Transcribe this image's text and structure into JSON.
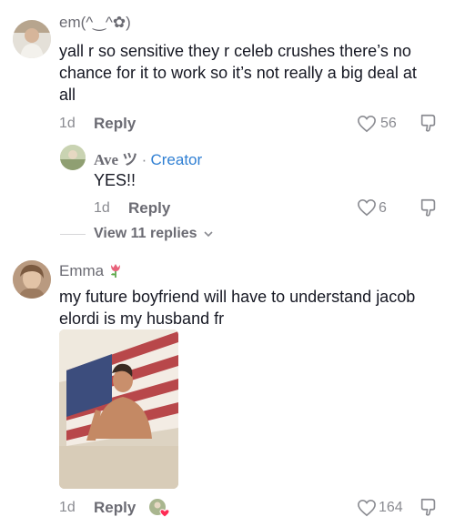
{
  "comments": [
    {
      "username": "em(^‿^✿)",
      "text_line1": "yall r so sensitive they r celeb crushes there’s no",
      "text_line2": "chance for it to work so it’s not really a big deal at",
      "text_line3": "all",
      "time": "1d",
      "reply_label": "Reply",
      "likes": "56"
    },
    {
      "username": "Ave ツ",
      "separator": "·",
      "badge": "Creator",
      "text": "YES!!",
      "time": "1d",
      "reply_label": "Reply",
      "likes": "6"
    },
    {
      "username": "Emma",
      "text_line1": "my future boyfriend will have to understand jacob",
      "text_line2": "elordi is my husband fr",
      "time": "1d",
      "reply_label": "Reply",
      "likes": "164"
    }
  ],
  "view_replies": "View 11 replies",
  "icons": {
    "like": "heart-outline-icon",
    "dislike": "thumbs-down-icon",
    "chevron": "chevron-down-icon",
    "tulip": "tulip-emoji-icon"
  },
  "colors": {
    "text": "#161823",
    "muted": "#8a8b91",
    "creator": "#2f7fd3"
  }
}
